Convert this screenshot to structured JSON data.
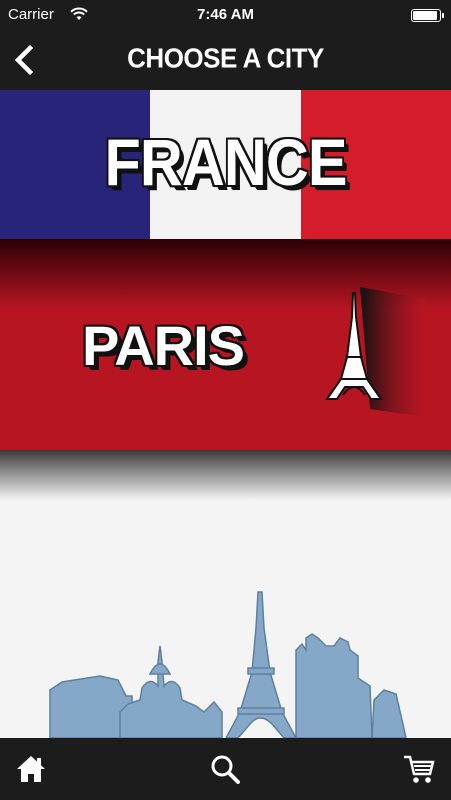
{
  "status_bar": {
    "carrier": "Carrier",
    "time": "7:46 AM"
  },
  "nav": {
    "title": "CHOOSE A CITY",
    "back_icon": "chevron-left-icon"
  },
  "banner": {
    "country": "FRANCE",
    "flag_colors": [
      "#27247a",
      "#f3f3f3",
      "#d41c2b"
    ]
  },
  "cities": [
    {
      "name": "PARIS",
      "icon": "eiffel-tower-icon",
      "color": "#b81523"
    }
  ],
  "tab_bar": {
    "icons": [
      "home-icon",
      "search-icon",
      "cart-icon"
    ]
  },
  "colors": {
    "bars": "#1c1c1c",
    "skyline": "#86a8c8"
  }
}
